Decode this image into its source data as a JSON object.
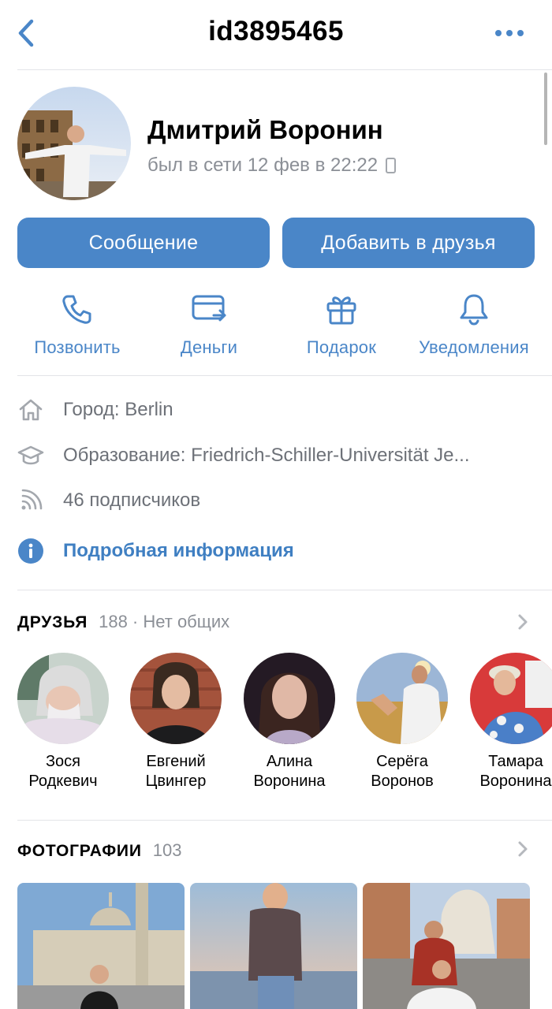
{
  "header": {
    "title": "id3895465"
  },
  "profile": {
    "name": "Дмитрий Воронин",
    "status": "был в сети 12 фев в 22:22"
  },
  "buttons": {
    "message": "Сообщение",
    "add_friend": "Добавить в друзья"
  },
  "actions": [
    {
      "label": "Позвонить",
      "icon": "phone-icon"
    },
    {
      "label": "Деньги",
      "icon": "money-transfer-icon"
    },
    {
      "label": "Подарок",
      "icon": "gift-icon"
    },
    {
      "label": "Уведомления",
      "icon": "bell-icon"
    }
  ],
  "info": {
    "city": "Город: Berlin",
    "education": "Образование: Friedrich-Schiller-Universität Je...",
    "followers": "46 подписчиков",
    "details_link": "Подробная информация"
  },
  "friends": {
    "heading": "ДРУЗЬЯ",
    "count": "188 · Нет общих",
    "items": [
      {
        "first": "Зося",
        "last": "Родкевич"
      },
      {
        "first": "Евгений",
        "last": "Цвингер"
      },
      {
        "first": "Алина",
        "last": "Воронина"
      },
      {
        "first": "Серёга",
        "last": "Воронов"
      },
      {
        "first": "Тамара",
        "last": "Воронина"
      }
    ]
  },
  "photos": {
    "heading": "ФОТОГРАФИИ",
    "count": "103"
  },
  "colors": {
    "accent": "#4a86c8",
    "link": "#3f7fc2",
    "secondary_text": "#8b8f96",
    "divider": "#e3e4e8"
  }
}
